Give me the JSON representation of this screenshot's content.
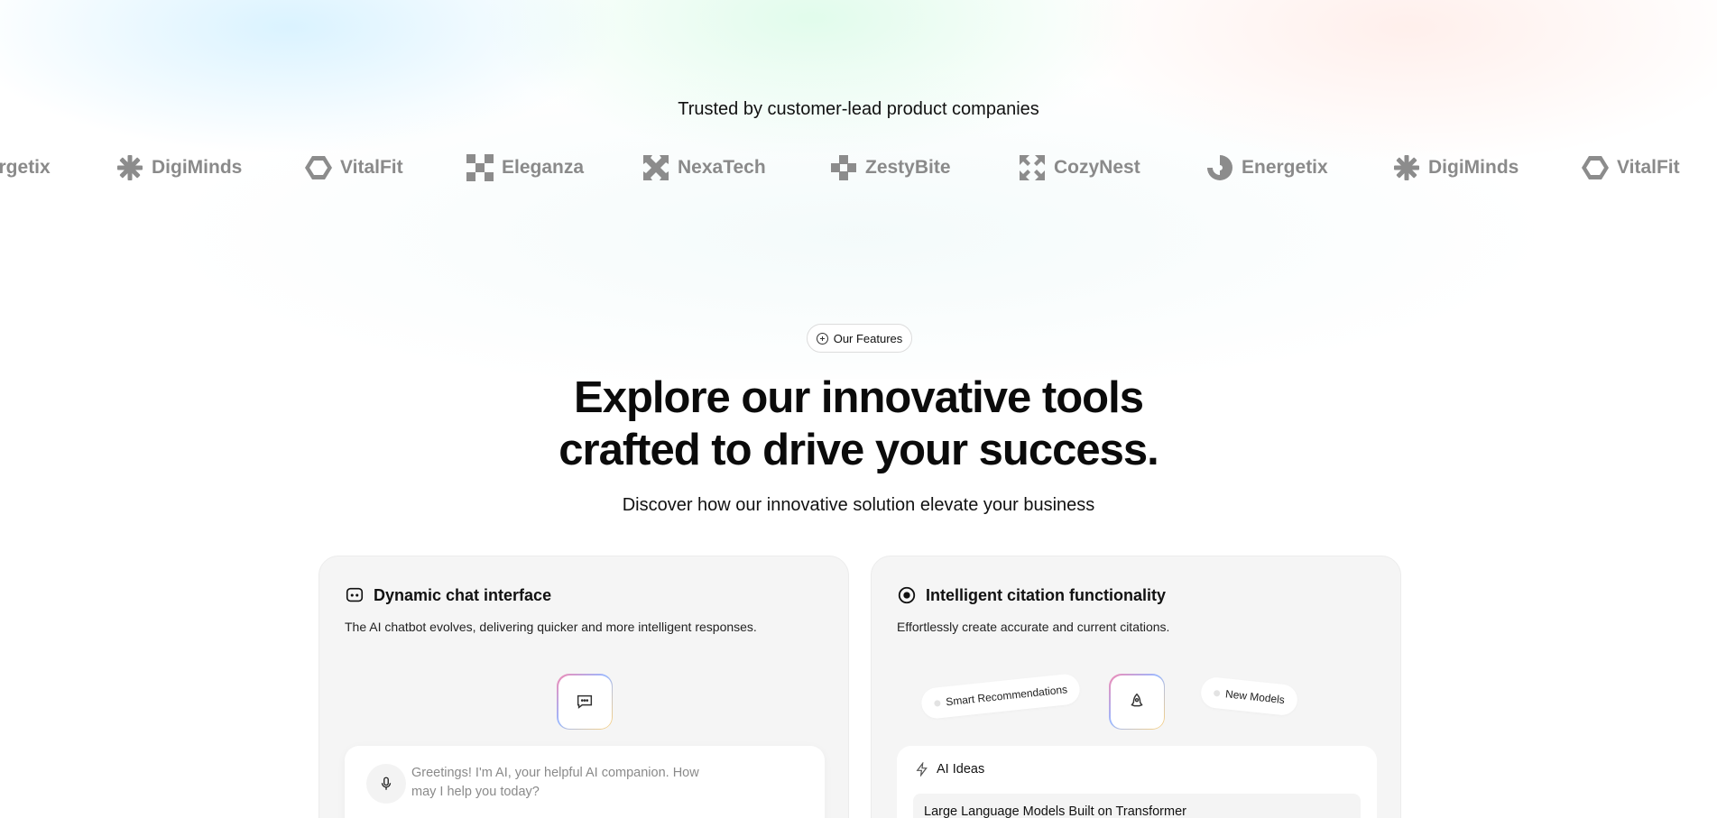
{
  "trusted": {
    "heading": "Trusted by customer-lead product companies"
  },
  "logos": [
    {
      "name": "Energetix",
      "icon": "swirl-icon"
    },
    {
      "name": "DigiMinds",
      "icon": "asterisk-icon"
    },
    {
      "name": "VitalFit",
      "icon": "hexagon-icon"
    },
    {
      "name": "Eleganza",
      "icon": "checker-icon"
    },
    {
      "name": "NexaTech",
      "icon": "x-arrows-icon"
    },
    {
      "name": "ZestyBite",
      "icon": "pixel-cross-icon"
    },
    {
      "name": "CozyNest",
      "icon": "expand-icon"
    },
    {
      "name": "Energetix",
      "icon": "swirl-icon"
    },
    {
      "name": "DigiMinds",
      "icon": "asterisk-icon"
    },
    {
      "name": "VitalFit",
      "icon": "hexagon-icon"
    }
  ],
  "features": {
    "pill_label": "Our Features",
    "headline_line1": "Explore our innovative tools",
    "headline_line2": "crafted to drive your success.",
    "subheading": "Discover how our innovative solution elevate your business"
  },
  "cards": {
    "chat": {
      "title": "Dynamic chat interface",
      "description": "The AI chatbot evolves, delivering quicker and more intelligent responses.",
      "icon": "chat-bubble-icon",
      "chat_placeholder": "Greetings! I'm AI, your helpful AI companion. How may I help you today?"
    },
    "citation": {
      "title": "Intelligent citation functionality",
      "description": "Effortlessly create accurate and current citations.",
      "icon": "target-icon",
      "tag_left": "Smart Recommendations",
      "tag_right": "New Models",
      "ideas_heading": "AI Ideas",
      "idea_item": "Large Language Models Built on Transformer"
    }
  }
}
